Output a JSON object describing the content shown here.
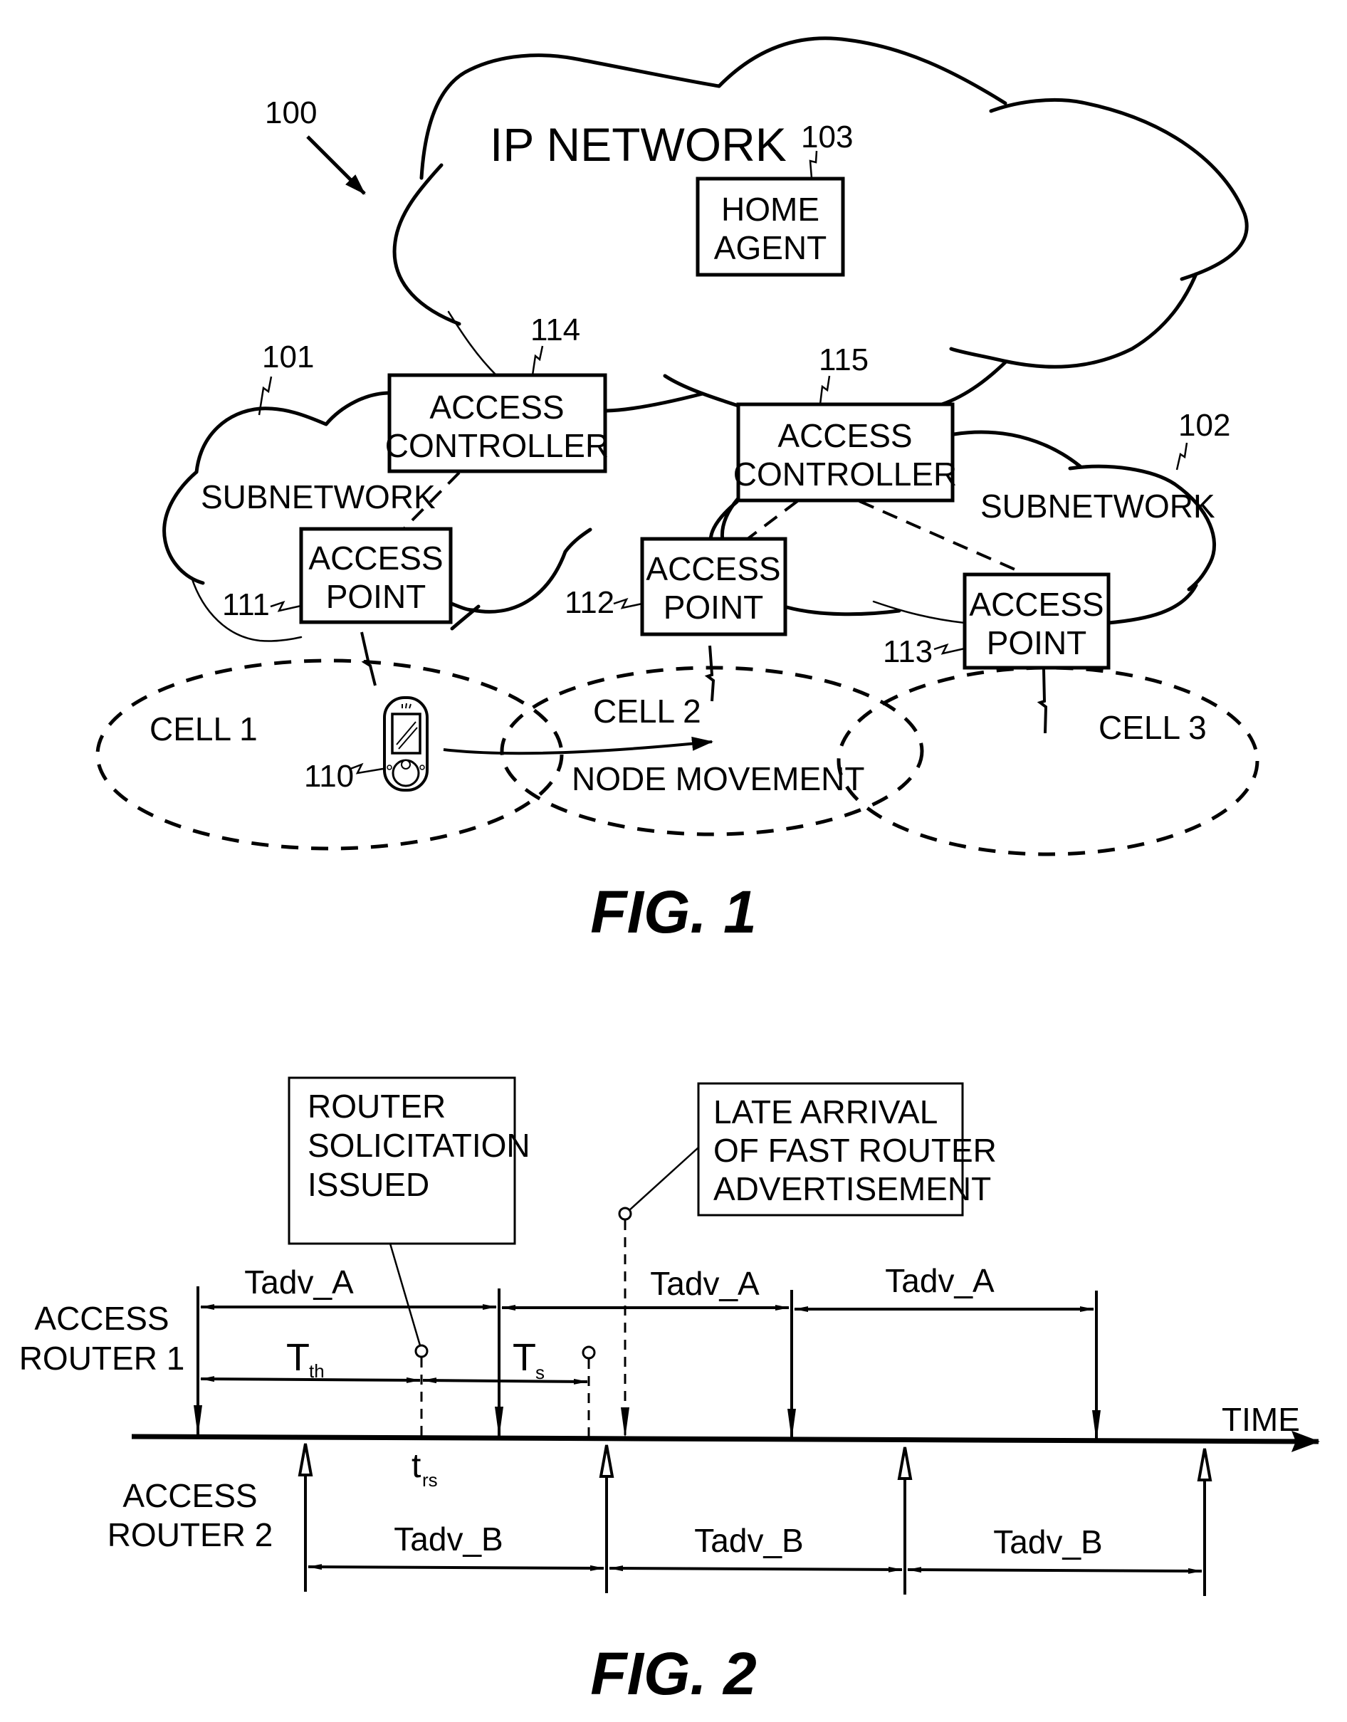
{
  "figure1": {
    "caption": "FIG. 1",
    "system_ref": "100",
    "ip_network": {
      "label": "IP NETWORK"
    },
    "home_agent": {
      "ref": "103",
      "line1": "HOME",
      "line2": "AGENT"
    },
    "access_controllers": [
      {
        "ref": "114",
        "line1": "ACCESS",
        "line2": "CONTROLLER"
      },
      {
        "ref": "115",
        "line1": "ACCESS",
        "line2": "CONTROLLER"
      }
    ],
    "subnetworks": [
      {
        "ref": "101",
        "label": "SUBNETWORK"
      },
      {
        "ref": "102",
        "label": "SUBNETWORK"
      }
    ],
    "access_points": [
      {
        "ref": "111",
        "line1": "ACCESS",
        "line2": "POINT"
      },
      {
        "ref": "112",
        "line1": "ACCESS",
        "line2": "POINT"
      },
      {
        "ref": "113",
        "line1": "ACCESS",
        "line2": "POINT"
      }
    ],
    "cells": [
      {
        "label": "CELL 1"
      },
      {
        "label": "CELL 2"
      },
      {
        "label": "CELL 3"
      }
    ],
    "mobile_node": {
      "ref": "110",
      "icon": "mobile-phone-icon"
    },
    "movement_label": "NODE MOVEMENT"
  },
  "figure2": {
    "caption": "FIG. 2",
    "time_label": "TIME",
    "router1_label": {
      "line1": "ACCESS",
      "line2": "ROUTER 1"
    },
    "router2_label": {
      "line1": "ACCESS",
      "line2": "ROUTER 2"
    },
    "callout_solicitation": {
      "line1": "ROUTER",
      "line2": "SOLICITATION",
      "line3": "ISSUED"
    },
    "callout_late_arrival": {
      "line1": "LATE ARRIVAL",
      "line2": "OF FAST ROUTER",
      "line3": "ADVERTISEMENT"
    },
    "intervals_router1": [
      "Tadv_A",
      "Tadv_A",
      "Tadv_A"
    ],
    "intervals_router2": [
      "Tadv_B",
      "Tadv_B",
      "Tadv_B"
    ],
    "t_threshold": {
      "main": "T",
      "sub": "th"
    },
    "t_s": {
      "main": "T",
      "sub": "s"
    },
    "t_rs": {
      "main": "t",
      "sub": "rs"
    }
  }
}
